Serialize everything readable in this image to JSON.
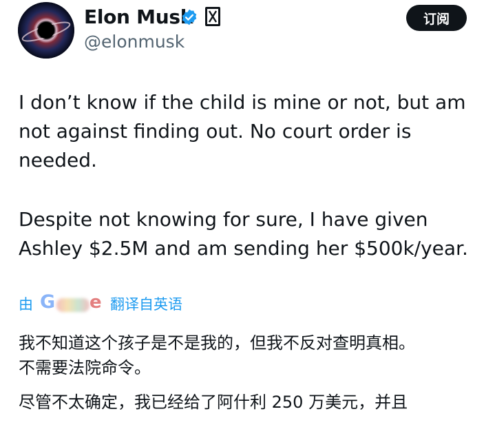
{
  "profile": {
    "name": "Elon Musk",
    "handle": "@elonmusk",
    "verified_color": "#1d9bf0",
    "avatar_icon": "black-hole-avatar",
    "affiliate_icon": "x-affiliate-badge"
  },
  "header": {
    "subscribe_label": "订阅"
  },
  "tweet": {
    "paragraph1_line1": "I don’t know if the child is mine or not, but am",
    "paragraph1_line2": "not against finding out. No court order is",
    "paragraph1_line3": "needed.",
    "paragraph2_line1": "Despite not knowing for sure, I have given",
    "paragraph2_line2": "Ashley $2.5M and am sending her $500k/year."
  },
  "translation": {
    "by_label": "由",
    "provider_icon": "google-logo",
    "translated_from": "翻译自英语",
    "paragraph1_line1": "我不知道这个孩子是不是我的，但我不反对查明真相。",
    "paragraph1_line2": "不需要法院命令。",
    "paragraph2_line1": "尽管不太确定，我已经给了阿什利 250 万美元，并且",
    "link_color": "#1d9bf0"
  }
}
